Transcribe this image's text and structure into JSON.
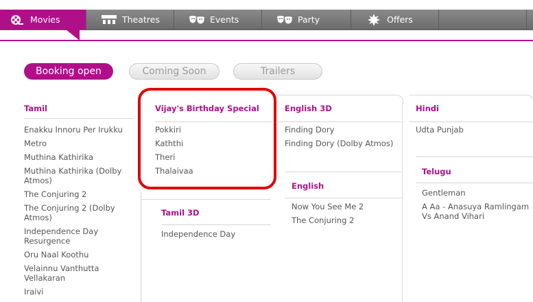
{
  "nav": {
    "items": [
      {
        "label": "Movies",
        "icon": "film-reel-icon"
      },
      {
        "label": "Theatres",
        "icon": "theatre-seats-icon"
      },
      {
        "label": "Events",
        "icon": "masks-icon"
      },
      {
        "label": "Party",
        "icon": "masks-icon"
      },
      {
        "label": "Offers",
        "icon": "starburst-icon"
      }
    ]
  },
  "filters": {
    "booking_open": "Booking open",
    "coming_soon": "Coming Soon",
    "trailers": "Trailers"
  },
  "columns": {
    "tamil": {
      "title": "Tamil",
      "movies": [
        "Enakku Innoru Per Irukku",
        "Metro",
        "Muthina Kathirika",
        "Muthina Kathirika (Dolby Atmos)",
        "The Conjuring 2",
        "The Conjuring 2 (Dolby Atmos)",
        "Independence Day Resurgence",
        "Oru Naal Koothu",
        "Velainnu Vanthutta Vellakaran",
        "Iraivi"
      ]
    },
    "vijay": {
      "title": "Vijay's Birthday Special",
      "movies": [
        "Pokkiri",
        "Kaththi",
        "Theri",
        "Thalaivaa"
      ]
    },
    "tamil3d": {
      "title": "Tamil 3D",
      "movies": [
        "Independence Day"
      ]
    },
    "english3d": {
      "title": "English 3D",
      "movies": [
        "Finding Dory",
        "Finding Dory (Dolby Atmos)"
      ]
    },
    "english": {
      "title": "English",
      "movies": [
        "Now You See Me 2",
        "The Conjuring 2"
      ]
    },
    "hindi": {
      "title": "Hindi",
      "movies": [
        "Udta Punjab"
      ]
    },
    "telugu": {
      "title": "Telugu",
      "movies": [
        "Gentleman",
        "A Aa - Anasuya Ramlingam Vs Anand Vihari"
      ]
    }
  },
  "colors": {
    "accent": "#b00f8a",
    "highlight": "#e00000"
  }
}
